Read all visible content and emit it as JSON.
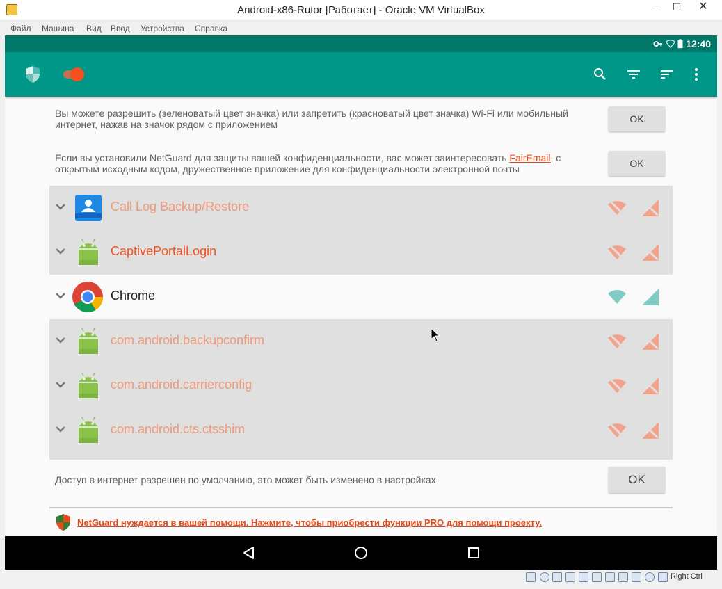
{
  "window": {
    "title": "Android-x86-Rutor [Работает] - Oracle VM VirtualBox",
    "minimize": "–",
    "maximize": "☐",
    "close": "✕"
  },
  "menu": [
    "Файл",
    "Машина",
    "Вид",
    "Ввод",
    "Устройства",
    "Справка"
  ],
  "statusbar": {
    "time": "12:40"
  },
  "notices": {
    "wifi_help": "Вы можете разрешить (зеленоватый цвет значка) или запретить (красноватый цвет значка) Wi-Fi или мобильный интернет, нажав на значок рядом с приложением",
    "fairemail_before": "Если вы установили NetGuard для защиты вашей конфиденциальности, вас может заинтересовать ",
    "fairemail_link": "FairEmail",
    "fairemail_after": ", с открытым исходным кодом, дружественное приложение для конфиденциальности электронной почты",
    "default_access": "Доступ в интернет разрешен по умолчанию, это может быть изменено в настройках",
    "ok": "OK",
    "pro": "NetGuard нуждается в вашей помощи. Нажмите, чтобы приобрести функции PRO для помощи проекту."
  },
  "apps": [
    {
      "name": "Call Log Backup/Restore",
      "style": "faded",
      "blocked": true,
      "icon": "contacts-icon"
    },
    {
      "name": "CaptivePortalLogin",
      "style": "orange",
      "blocked": true,
      "icon": "android-icon"
    },
    {
      "name": "Chrome",
      "style": "dark",
      "blocked": false,
      "icon": "chrome-icon"
    },
    {
      "name": "com.android.backupconfirm",
      "style": "faded",
      "blocked": true,
      "icon": "android-icon"
    },
    {
      "name": "com.android.carrierconfig",
      "style": "faded",
      "blocked": true,
      "icon": "android-icon"
    },
    {
      "name": "com.android.cts.ctsshim",
      "style": "faded",
      "blocked": true,
      "icon": "android-icon"
    }
  ],
  "host_status": {
    "right_ctrl": "Right Ctrl"
  },
  "colors": {
    "teal": "#009688",
    "teal_dark": "#00796b",
    "blocked": "#f4a28c",
    "allowed": "#80cbc4",
    "accent": "#e64a19"
  }
}
